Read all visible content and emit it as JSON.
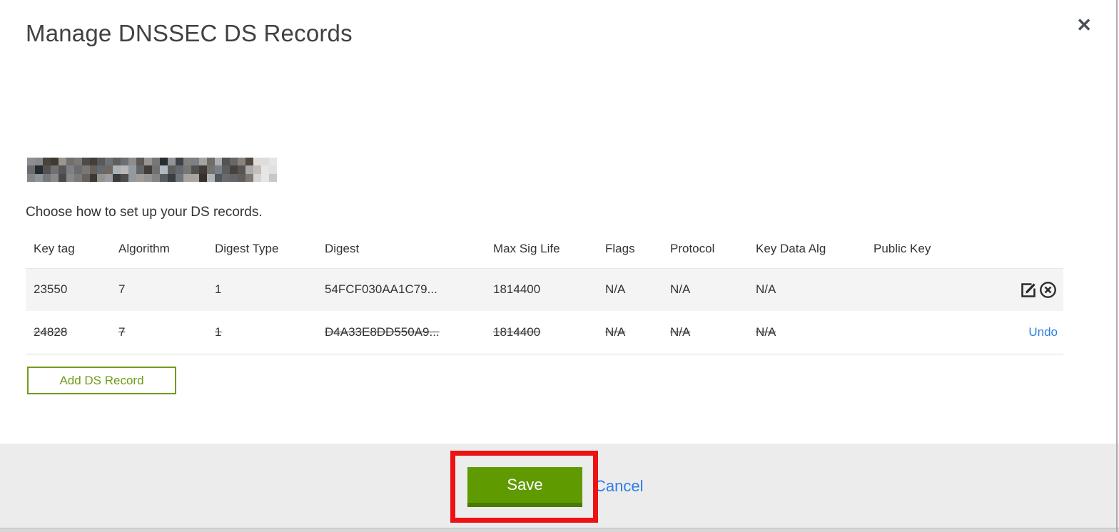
{
  "dialog": {
    "title": "Manage DNSSEC DS Records",
    "instruction": "Choose how to set up your DS records."
  },
  "icons": {
    "close_glyph": "✕"
  },
  "table": {
    "columns": [
      "Key tag",
      "Algorithm",
      "Digest Type",
      "Digest",
      "Max Sig Life",
      "Flags",
      "Protocol",
      "Key Data Alg",
      "Public Key"
    ],
    "rows": [
      {
        "key_tag": "23550",
        "algorithm": "7",
        "digest_type": "1",
        "digest": "54FCF030AA1C79...",
        "max_sig_life": "1814400",
        "flags": "N/A",
        "protocol": "N/A",
        "key_data_alg": "N/A",
        "public_key": "",
        "state": "normal"
      },
      {
        "key_tag": "24828",
        "algorithm": "7",
        "digest_type": "1",
        "digest": "D4A33E8DD550A9...",
        "max_sig_life": "1814400",
        "flags": "N/A",
        "protocol": "N/A",
        "key_data_alg": "N/A",
        "public_key": "",
        "state": "deleted",
        "undo_label": "Undo"
      }
    ],
    "add_button_label": "Add DS Record"
  },
  "footer": {
    "save_label": "Save",
    "cancel_label": "Cancel"
  },
  "colors": {
    "save_green": "#5f9b00",
    "save_green_dark": "#4a7a00",
    "add_outline_green": "#6f9c1c",
    "link_blue": "#2e7de4",
    "annotation_red": "#ee1212",
    "row_bg": "#f4f4f4",
    "footer_bg": "#ececec"
  }
}
